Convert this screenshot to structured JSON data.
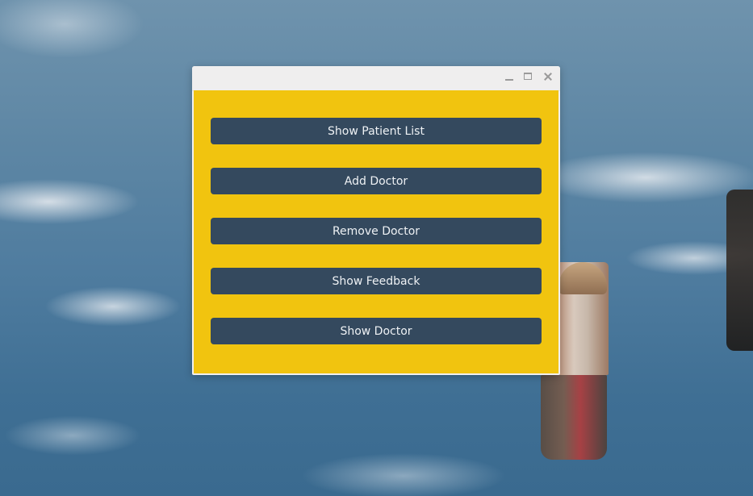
{
  "window": {
    "controls": {
      "minimize_icon": "minimize-icon",
      "maximize_icon": "maximize-icon",
      "close_icon": "close-icon"
    },
    "background_color": "#f1c40f",
    "button_color": "#34495e",
    "buttons": [
      {
        "label": "Show Patient List"
      },
      {
        "label": "Add Doctor"
      },
      {
        "label": "Remove Doctor"
      },
      {
        "label": "Show Feedback"
      },
      {
        "label": "Show Doctor"
      }
    ]
  }
}
